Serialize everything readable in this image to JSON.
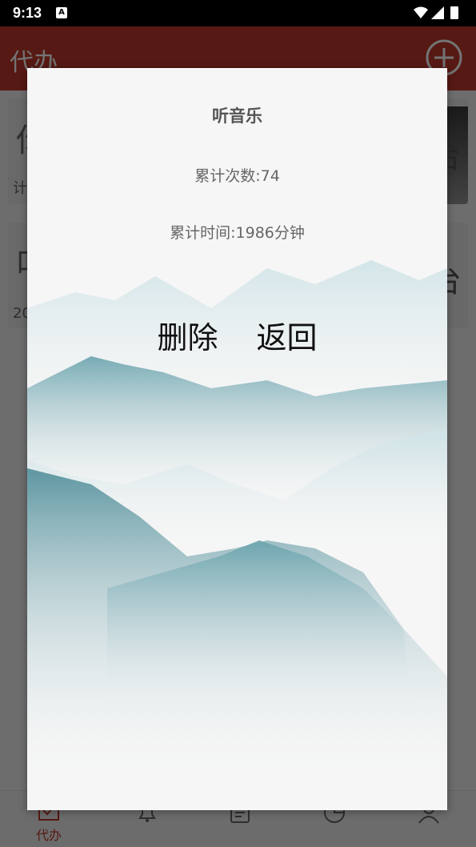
{
  "status_bar": {
    "time": "9:13",
    "notification_icon": "A"
  },
  "app_bar": {
    "title": "代办",
    "add_icon": "plus-circle-icon"
  },
  "list_behind": [
    {
      "big_text": "你",
      "small_text": "计",
      "right_text": "台"
    },
    {
      "big_text": "叫",
      "small_text": "20",
      "right_text": "台"
    }
  ],
  "dialog": {
    "title": "听音乐",
    "count_text": "累计次数:74",
    "time_text": "累计时间:1986分钟",
    "delete_label": "删除",
    "back_label": "返回"
  },
  "bottom_nav": {
    "items": [
      {
        "label": "代办",
        "icon": "todo-check-icon"
      },
      {
        "label": "",
        "icon": "bell-icon"
      },
      {
        "label": "",
        "icon": "notes-icon"
      },
      {
        "label": "",
        "icon": "pie-chart-icon"
      },
      {
        "label": "",
        "icon": "user-icon"
      }
    ]
  },
  "colors": {
    "accent": "#c0392b",
    "mountain": "#5b97a3"
  }
}
